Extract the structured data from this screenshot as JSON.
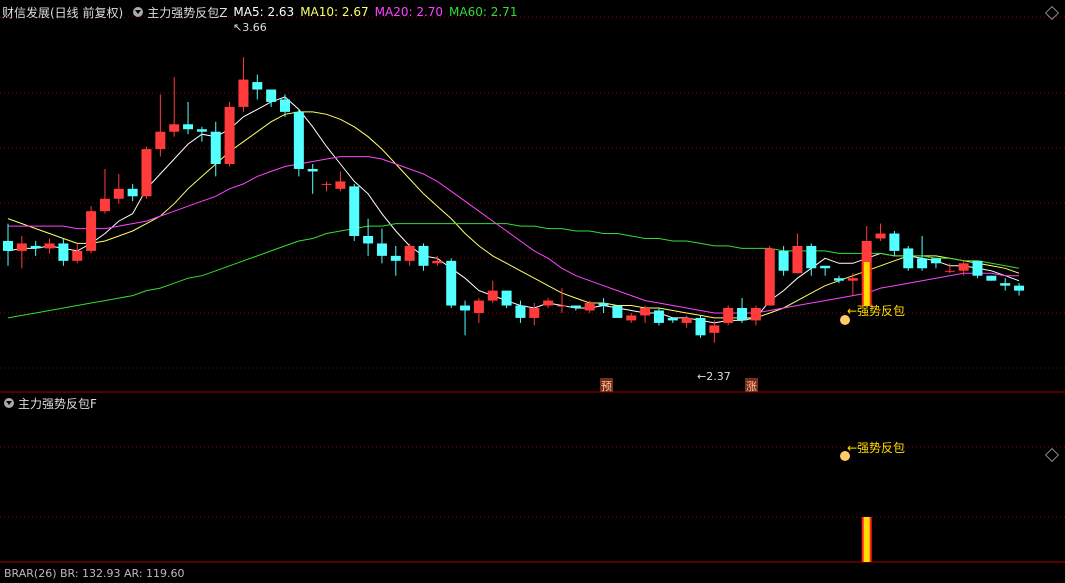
{
  "main_header": {
    "stock": "财信发展(日线 前复权)",
    "indicator": "主力强势反包Z",
    "ma5": "MA5: 2.63",
    "ma10": "MA10: 2.67",
    "ma20": "MA20: 2.70",
    "ma60": "MA60: 2.71"
  },
  "sub_header": {
    "indicator": "主力强势反包F"
  },
  "bottom_header": {
    "text": "BRAR(26) BR: 132.93 AR: 119.60"
  },
  "colors": {
    "up": "#ff3b3b",
    "down": "#54ffff",
    "ma5": "#ffffff",
    "ma10": "#ffff66",
    "ma20": "#ff44ff",
    "ma60": "#33dd33",
    "signal": "#ffdd00",
    "grid": "#8a0000"
  },
  "annotations": {
    "high": "3.66",
    "low": "2.37",
    "signal_main": "←强势反包",
    "signal_sub": "←强势反包",
    "badge_yu": "预",
    "badge_zhang": "涨"
  },
  "chart_data": {
    "type": "candlestick",
    "ylim": [
      2.3,
      3.75
    ],
    "x": [
      1,
      2,
      3,
      4,
      5,
      6,
      7,
      8,
      9,
      10,
      11,
      12,
      13,
      14,
      15,
      16,
      17,
      18,
      19,
      20,
      21,
      22,
      23,
      24,
      25,
      26,
      27,
      28,
      29,
      30,
      31,
      32,
      33,
      34,
      35,
      36,
      37,
      38,
      39,
      40,
      41,
      42,
      43,
      44,
      45,
      46,
      47,
      48,
      49,
      50,
      51,
      52,
      53,
      54,
      55,
      56,
      57,
      58,
      59,
      60,
      61,
      62,
      63,
      64,
      65,
      66,
      67,
      68,
      69,
      70,
      71,
      72,
      73,
      74
    ],
    "candles": [
      [
        2.86,
        2.82,
        2.93,
        2.76
      ],
      [
        2.82,
        2.85,
        2.88,
        2.75
      ],
      [
        2.84,
        2.83,
        2.86,
        2.8
      ],
      [
        2.83,
        2.85,
        2.87,
        2.81
      ],
      [
        2.85,
        2.78,
        2.87,
        2.76
      ],
      [
        2.78,
        2.82,
        2.85,
        2.77
      ],
      [
        2.82,
        2.98,
        3.0,
        2.81
      ],
      [
        2.98,
        3.03,
        3.15,
        2.97
      ],
      [
        3.03,
        3.07,
        3.13,
        3.01
      ],
      [
        3.07,
        3.04,
        3.09,
        3.02
      ],
      [
        3.04,
        3.23,
        3.24,
        3.03
      ],
      [
        3.23,
        3.3,
        3.45,
        3.2
      ],
      [
        3.3,
        3.33,
        3.52,
        3.28
      ],
      [
        3.33,
        3.31,
        3.42,
        3.29
      ],
      [
        3.31,
        3.3,
        3.32,
        3.26
      ],
      [
        3.3,
        3.17,
        3.34,
        3.12
      ],
      [
        3.17,
        3.4,
        3.42,
        3.16
      ],
      [
        3.4,
        3.51,
        3.6,
        3.38
      ],
      [
        3.5,
        3.47,
        3.53,
        3.43
      ],
      [
        3.47,
        3.42,
        3.46,
        3.4
      ],
      [
        3.43,
        3.38,
        3.45,
        3.36
      ],
      [
        3.38,
        3.15,
        3.39,
        3.12
      ],
      [
        3.15,
        3.14,
        3.17,
        3.05
      ],
      [
        3.09,
        3.09,
        3.1,
        3.06
      ],
      [
        3.07,
        3.1,
        3.14,
        3.06
      ],
      [
        3.08,
        2.88,
        3.09,
        2.86
      ],
      [
        2.88,
        2.85,
        2.95,
        2.8
      ],
      [
        2.85,
        2.8,
        2.91,
        2.77
      ],
      [
        2.8,
        2.78,
        2.84,
        2.72
      ],
      [
        2.78,
        2.84,
        2.85,
        2.76
      ],
      [
        2.84,
        2.76,
        2.85,
        2.74
      ],
      [
        2.77,
        2.78,
        2.8,
        2.76
      ],
      [
        2.78,
        2.6,
        2.79,
        2.59
      ],
      [
        2.6,
        2.58,
        2.62,
        2.48
      ],
      [
        2.57,
        2.62,
        2.63,
        2.53
      ],
      [
        2.62,
        2.66,
        2.7,
        2.61
      ],
      [
        2.66,
        2.6,
        2.66,
        2.59
      ],
      [
        2.6,
        2.55,
        2.62,
        2.53
      ],
      [
        2.55,
        2.59,
        2.61,
        2.52
      ],
      [
        2.6,
        2.62,
        2.63,
        2.59
      ],
      [
        2.6,
        2.6,
        2.67,
        2.57
      ],
      [
        2.6,
        2.59,
        2.6,
        2.58
      ],
      [
        2.58,
        2.61,
        2.62,
        2.57
      ],
      [
        2.61,
        2.6,
        2.63,
        2.57
      ],
      [
        2.6,
        2.55,
        2.6,
        2.55
      ],
      [
        2.54,
        2.56,
        2.57,
        2.53
      ],
      [
        2.56,
        2.59,
        2.6,
        2.53
      ],
      [
        2.58,
        2.53,
        2.59,
        2.52
      ],
      [
        2.55,
        2.54,
        2.55,
        2.53
      ],
      [
        2.53,
        2.55,
        2.56,
        2.51
      ],
      [
        2.55,
        2.48,
        2.56,
        2.47
      ],
      [
        2.49,
        2.52,
        2.54,
        2.45
      ],
      [
        2.53,
        2.59,
        2.6,
        2.52
      ],
      [
        2.59,
        2.54,
        2.63,
        2.53
      ],
      [
        2.54,
        2.59,
        2.6,
        2.52
      ],
      [
        2.6,
        2.83,
        2.84,
        2.6
      ],
      [
        2.82,
        2.74,
        2.84,
        2.72
      ],
      [
        2.73,
        2.84,
        2.89,
        2.73
      ],
      [
        2.84,
        2.75,
        2.85,
        2.72
      ],
      [
        2.76,
        2.75,
        2.76,
        2.72
      ],
      [
        2.71,
        2.7,
        2.72,
        2.69
      ],
      [
        2.7,
        2.71,
        2.73,
        2.64
      ],
      [
        2.71,
        2.86,
        2.92,
        2.71
      ],
      [
        2.87,
        2.89,
        2.93,
        2.86
      ],
      [
        2.89,
        2.82,
        2.9,
        2.8
      ],
      [
        2.83,
        2.75,
        2.84,
        2.74
      ],
      [
        2.79,
        2.75,
        2.88,
        2.74
      ],
      [
        2.79,
        2.77,
        2.79,
        2.75
      ],
      [
        2.74,
        2.74,
        2.77,
        2.73
      ],
      [
        2.74,
        2.77,
        2.78,
        2.72
      ],
      [
        2.78,
        2.72,
        2.78,
        2.71
      ],
      [
        2.72,
        2.7,
        2.72,
        2.7
      ],
      [
        2.69,
        2.68,
        2.71,
        2.66
      ],
      [
        2.68,
        2.66,
        2.69,
        2.64
      ]
    ],
    "series": [
      {
        "name": "MA5",
        "values": [
          2.82,
          2.83,
          2.83,
          2.84,
          2.83,
          2.82,
          2.85,
          2.89,
          2.94,
          2.97,
          3.07,
          3.13,
          3.19,
          3.25,
          3.29,
          3.28,
          3.31,
          3.36,
          3.39,
          3.42,
          3.44,
          3.39,
          3.32,
          3.24,
          3.17,
          3.1,
          3.05,
          2.97,
          2.9,
          2.84,
          2.8,
          2.79,
          2.75,
          2.71,
          2.66,
          2.64,
          2.62,
          2.6,
          2.59,
          2.61,
          2.6,
          2.59,
          2.59,
          2.6,
          2.59,
          2.58,
          2.57,
          2.57,
          2.55,
          2.55,
          2.54,
          2.53,
          2.54,
          2.54,
          2.55,
          2.62,
          2.66,
          2.71,
          2.75,
          2.79,
          2.77,
          2.77,
          2.79,
          2.81,
          2.8,
          2.8,
          2.79,
          2.78,
          2.76,
          2.76,
          2.75,
          2.74,
          2.72,
          2.7
        ]
      },
      {
        "name": "MA10",
        "values": [
          2.95,
          2.93,
          2.91,
          2.89,
          2.87,
          2.85,
          2.85,
          2.86,
          2.88,
          2.9,
          2.93,
          2.96,
          3.01,
          3.07,
          3.12,
          3.17,
          3.22,
          3.26,
          3.3,
          3.34,
          3.37,
          3.38,
          3.38,
          3.37,
          3.35,
          3.32,
          3.28,
          3.23,
          3.17,
          3.11,
          3.05,
          3.0,
          2.95,
          2.89,
          2.84,
          2.8,
          2.77,
          2.74,
          2.71,
          2.68,
          2.65,
          2.63,
          2.61,
          2.61,
          2.6,
          2.6,
          2.59,
          2.59,
          2.58,
          2.57,
          2.56,
          2.55,
          2.55,
          2.55,
          2.55,
          2.57,
          2.59,
          2.62,
          2.65,
          2.68,
          2.7,
          2.72,
          2.74,
          2.76,
          2.78,
          2.8,
          2.8,
          2.8,
          2.79,
          2.78,
          2.77,
          2.76,
          2.75,
          2.73
        ]
      },
      {
        "name": "MA20",
        "values": [
          2.92,
          2.92,
          2.92,
          2.92,
          2.92,
          2.91,
          2.91,
          2.91,
          2.92,
          2.93,
          2.94,
          2.96,
          2.98,
          3.0,
          3.02,
          3.04,
          3.07,
          3.09,
          3.12,
          3.14,
          3.16,
          3.17,
          3.18,
          3.19,
          3.2,
          3.2,
          3.2,
          3.19,
          3.17,
          3.15,
          3.13,
          3.1,
          3.06,
          3.02,
          2.98,
          2.94,
          2.9,
          2.86,
          2.82,
          2.79,
          2.75,
          2.72,
          2.7,
          2.68,
          2.66,
          2.64,
          2.62,
          2.61,
          2.6,
          2.59,
          2.58,
          2.57,
          2.57,
          2.57,
          2.57,
          2.58,
          2.59,
          2.6,
          2.61,
          2.62,
          2.63,
          2.64,
          2.65,
          2.67,
          2.68,
          2.69,
          2.7,
          2.71,
          2.72,
          2.73,
          2.73,
          2.73,
          2.72,
          2.72
        ]
      },
      {
        "name": "MA60",
        "values": [
          2.55,
          2.56,
          2.57,
          2.58,
          2.59,
          2.6,
          2.61,
          2.62,
          2.63,
          2.64,
          2.66,
          2.67,
          2.69,
          2.71,
          2.72,
          2.74,
          2.76,
          2.78,
          2.8,
          2.82,
          2.84,
          2.86,
          2.87,
          2.89,
          2.9,
          2.91,
          2.92,
          2.92,
          2.93,
          2.93,
          2.93,
          2.93,
          2.93,
          2.93,
          2.93,
          2.93,
          2.93,
          2.92,
          2.92,
          2.91,
          2.91,
          2.9,
          2.9,
          2.89,
          2.89,
          2.88,
          2.87,
          2.87,
          2.86,
          2.86,
          2.85,
          2.84,
          2.84,
          2.83,
          2.83,
          2.83,
          2.82,
          2.82,
          2.82,
          2.82,
          2.81,
          2.81,
          2.81,
          2.81,
          2.8,
          2.8,
          2.8,
          2.79,
          2.79,
          2.78,
          2.78,
          2.77,
          2.76,
          2.75
        ]
      }
    ],
    "signal_index": 62
  }
}
